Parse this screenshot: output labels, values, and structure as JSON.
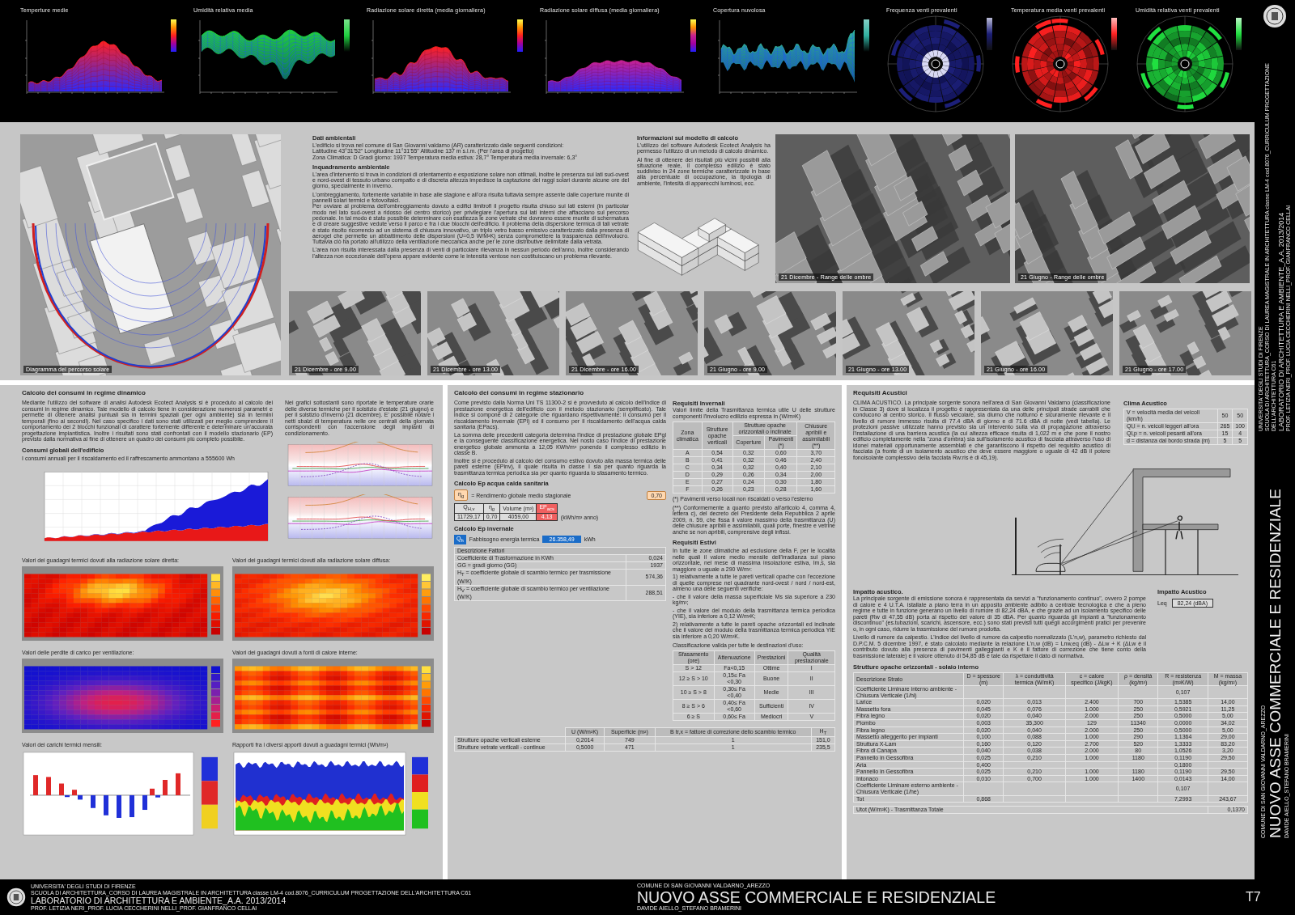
{
  "climate_strip": {
    "charts": [
      {
        "kind": "area",
        "title": "Temperture medie",
        "color": "#ff2020"
      },
      {
        "kind": "band",
        "title": "Umidità relativa media",
        "color": "#20d040"
      },
      {
        "kind": "area",
        "title": "Radiazione solare diretta (media giornaliera)",
        "color": "#ff2020"
      },
      {
        "kind": "area",
        "title": "Radiazione solare diffusa (media giornaliera)",
        "color": "#c82090"
      },
      {
        "kind": "band",
        "title": "Copertura nuvolosa",
        "color": "#30b0a0"
      },
      {
        "kind": "rose",
        "title": "Frequenza venti prevalenti",
        "color": "#1c1f78"
      },
      {
        "kind": "rose",
        "title": "Temperatura media venti prevalenti",
        "color": "#ff2020"
      },
      {
        "kind": "rose",
        "title": "Umidità relativa venti prevalenti",
        "color": "#20e040"
      }
    ]
  },
  "side_strip": {
    "credits": [
      {
        "text": "UNIVERSITA' DEGLI STUDI DI FIRENZE",
        "kind": "small"
      },
      {
        "text": "SCUOLA DI ARCHITETTURA_CORSO DI LAUREA MAGISTRALE IN ARCHITETTURA classe LM-4 cod.8076_CURRICULUM PROGETTAZIONE DELL'ARCHITETTURA C61",
        "kind": "small"
      },
      {
        "text": "LABORATORIO DI ARCHITETTURA E AMBIENTE_A.A. 2013/2014",
        "kind": "large"
      },
      {
        "text": "PROF. LETIZIA NERI_PROF. LUCIA CECCHERINI NELLI_PROF. GIANFRANCO CELLAI",
        "kind": "small"
      }
    ],
    "place": "COMUNE DI SAN GIOVANNI VALDARNO_AREZZO",
    "title": "NUOVO ASSE COMMERCIALE E RESIDENZIALE",
    "authors": "DAVIDE AIELLO_STEFANO BRAMERINI"
  },
  "site_analysis": {
    "sun_path_caption": "Diagramma del percorso solare",
    "environment": [
      {
        "kind": "heading",
        "text": "Dati ambientali"
      },
      {
        "kind": "paragraph",
        "text": "L'edificio si trova nel comune di San Giovanni valdarno (AR) caratterizzato dalle seguenti condizioni:"
      },
      {
        "kind": "line",
        "text": "Latitudine 43°31'52\"  Longitudine 11°31'55\"  Altitudine 137 m s.l.m. (Per l'area di progetto)"
      },
      {
        "kind": "line",
        "text": "Zona Climatica: D  Gradi giorno: 1937  Temperatura media estiva: 28,7°  Temperatura media invernale: 6,3°"
      },
      {
        "kind": "heading",
        "text": "Inquadramento ambientale"
      },
      {
        "kind": "paragraph",
        "text": "L'area d'intervento si trova in condizioni di orientamento e esposizione solare non ottimali, inoltre le presenza sui lati sud-ovest e nord-ovest di tessuto urbano compatto e di discreta altezza impedisce la captazione dei raggi solari durante alcune ore del giorno, specialmente in inverno."
      },
      {
        "kind": "paragraph",
        "text": "L'ombreggiamento, fortemente variabile in base alle stagione e all'ora risulta tuttavia sempre assente dalle coperture munite di pannelli solari termici e fotovoltaici."
      },
      {
        "kind": "line",
        "text": "Per ovviare al problema dell'ombreggiamento dovuto a edifici limitrofi il progetto risulta chiuso sui lati esterni (in particolar modo nel lato sud-ovest a ridosso del centro storico) per privilegiare l'apertura sui lati interni che affacciano sul percorso pedonale. In tal modo è stato possibile determinare con esattezza le zone vetrate che dovranno essere munite di schermatura e di creare suggestive vedute verso il parco e fra i due blocchi dell'edificio. Il problema della dispersione termica di tali vetrate è stato risolto ricorrendo ad un sistema di chiusura innovativo, un triplo vetro basso emissivo caratterizzato dalla presenza di aerogel che permette un abbattimento delle dispersioni (U=0,5 W/M²K) senza compromettere la trasparenza dell'involucro. Tuttavia ciò ha portato all'utilizzo della ventilazione meccanica anche per le zone distributive delimitate dalla vetrata."
      },
      {
        "kind": "paragraph",
        "text": "L'area non risulta interessata dalla presenza di venti di particolare rilevanza in nessun periodo dell'anno, inoltre considerando l'altezza non eccezionale dell'opera appare evidente come le intensità ventose non costituiscano un problema rilevante."
      }
    ],
    "model_info": [
      {
        "kind": "heading",
        "text": "Informazioni sul modello di calcolo"
      },
      {
        "kind": "paragraph",
        "text": "L'utilizzo del software Autodesk Ecotect Analysis ha permesso l'utilizzo di un metodo di calcolo dinamico."
      },
      {
        "kind": "paragraph",
        "text": "Al fine di ottenere dei risultati più vicini possibili alla situazione reale, il complesso edilizio è stato suddiviso in 24 zone termiche caratterizzate in base alla percentuale di occupazione, la tipologia di ambiente, l'intesità di apparecchi luminosi, ecc."
      }
    ],
    "renders": [
      {
        "caption": "21 Dicembre - Range delle ombre"
      },
      {
        "caption": "21 Giugno - Range delle ombre"
      }
    ],
    "shadow_studies": [
      {
        "caption": "21 Dicembre - ore 9.00"
      },
      {
        "caption": "21 Dicembre - ore 13.00"
      },
      {
        "caption": "21 Dicembre - ore 16.00"
      },
      {
        "caption": "21 Giugno - ore 9.00"
      },
      {
        "caption": "21 Giugno - ore 13.00"
      },
      {
        "caption": "21 Giugno - ore 16.00"
      },
      {
        "caption": "21 Giugno - ore 17.00"
      }
    ]
  },
  "dynamic_analysis": {
    "heading": "Calcolo dei consumi in regime dinamico",
    "intro": "Mediante l'utilizzo del software di analisi Autodesk Ecotect Analysis si è proceduto al calcolo dei consumi in regime dinamico. Tale modello di calcolo tiene in considerazione numerosi parametri e permette di ottenere analisi puntuali sia in termini spaziali (per ogni ambiente) sia in termini temporali (fino ai secondi). Nel caso specifico i dati sono stati utilizzati per meglio comprendere il comportamento dei 2 blocchi funzionali di carattere fortemente differente e determinare un'accurata progettazione impiantistica. Inoltre i risultati sono stati confrontati con il modello stazionario (EP) previsto dalla normativa al fine di ottenere un quadro dei consumi più completo possibile.",
    "note": "Nei grafici sottostanti sono riportate le temperature orarie delle diverse termiche per il solstizio d'estate (21 giugno) e per il solstizio d'inverno (21 dicembre). E' possibile notare i netti sbalzi di temperatura nelle ore centrali della giornata corrispondenti con l'accensione degli impianti di condizionamento.",
    "subheading": "Consumi globali dell'edificio",
    "total": "I consumi annuali per il riscaldamento ed il raffrescamento ammontano a 555600 Wh",
    "charts": [
      {
        "kind": "heatmap",
        "title": "Valori dei guadagni termici dovuti alla radiazione solare diretta:"
      },
      {
        "kind": "heatmap",
        "title": "Valori dei guadagni termici dovuti alla radiazione solare diffusa:"
      },
      {
        "kind": "heatmap",
        "title": "Valori delle perdite di carico per ventilazione:"
      },
      {
        "kind": "heatmap",
        "title": "Valori dei guadagni dovuti a fonti di calore interne:"
      },
      {
        "kind": "bars",
        "title": "Valori dei carichi termici mensili:"
      },
      {
        "kind": "ratios",
        "title": "Rapporti fra i diversi apporti dovuti a guadagni termici (Wh/m²)"
      }
    ]
  },
  "stationary_analysis": {
    "heading": "Calcolo dei consumi in regime stazionario",
    "paragraphs": [
      "Come previsto dalla Norma Uni TS 11300-2 si è provveduto al calcolo dell'indice di prestazione energetica dell'edificio con il metodo stazionario (semplificato). Tale indice si compone di 2 categorie che riguardano rispettivamente: il consumo per il riscaldamento invernale (EPi) ed il consumo per il riscaldamento dell'acqua calda sanitaria (EPacs).",
      "La somma delle precedenti categoria determina l'indice di prestazione globale EPgl e la conseguente classificazione energetica. Nel nosto caso l'indice di prestazione energetico globale ammonta a 12,05 KWh/m³ ponendo il complesso edilizio in classe B.",
      "Inoltre si è proceduto al calcolo del consumo estivo dovuto alla massa termica delle pareti esterne (EPinv), il quale risulta in classe I sia per quanto riguarda la trasmittanza termica periodica sia per quanto riguarda lo sfasamento termico."
    ],
    "acs": {
      "heading": "Calcolo Ep acqua calda sanitaria",
      "efficiency": {
        "symbol": "η$_{g}$",
        "label": "= Rendimento globale medio stagionale",
        "value": "0,70"
      },
      "columns": [
        "Q$_{H,v}$",
        "η$_{g}$",
        "Volume (m³)",
        "EP$_{acs}$"
      ],
      "row": [
        "11729,17",
        "0,70",
        "4059,00",
        "4,13"
      ],
      "unit": "(kWh/m³ anno)"
    },
    "winter": {
      "heading": "Calcolo Ep invernale",
      "demand": {
        "symbol": "Q$_{h}$",
        "label": "Fabbisogno energia termica",
        "value": "26.358,49",
        "unit": "kWh"
      },
      "factors_heading": "Descrizione Fattori",
      "factors": [
        {
          "label": "Coefficiente di Trasformazione in KWh",
          "value": "0,024"
        },
        {
          "label": "GG = gradi giorno (GG)",
          "value": "1937"
        },
        {
          "label": "H$_{T}$ = coefficiente globale di scambio termico per trasmissione (W/K)",
          "value": "574,36"
        },
        {
          "label": "H$_{V}$ = coefficiente globale di scambio termico per ventilazione (W/K)",
          "value": "288,51"
        }
      ],
      "transmission": {
        "columns": [
          "",
          "U (W/m²K)",
          "Superficie (m²)",
          "B tr,x = fattore di correzione dello scambio termico",
          "H$_{T}$"
        ],
        "rows": [
          [
            "Strutture opache verticali esterne",
            "0,2014",
            "749",
            "1",
            "151,0"
          ],
          [
            "Strutture vetrate verticali - continue",
            "0,5000",
            "471",
            "1",
            "235,5"
          ]
        ]
      }
    },
    "winter_requirements": {
      "heading": "Requisiti Invernali",
      "text": "Valori limite della Trasmittanza termica utile U delle strutture componenti l'involucro edilizio espressa in (W/m²K)",
      "group_header": "Strutture opache orizzontali o inclinate",
      "columns": [
        "Zona climatica",
        "Strutture opache verticali",
        "Coperture",
        "Pavimenti (*)",
        "Chiusure apribili e assimilabili (**)"
      ],
      "rows": [
        [
          "A",
          "0,54",
          "0,32",
          "0,60",
          "3,70"
        ],
        [
          "B",
          "0,41",
          "0,32",
          "0,46",
          "2,40"
        ],
        [
          "C",
          "0,34",
          "0,32",
          "0,40",
          "2,10"
        ],
        [
          "D",
          "0,29",
          "0,26",
          "0,34",
          "2,00"
        ],
        [
          "E",
          "0,27",
          "0,24",
          "0,30",
          "1,80"
        ],
        [
          "F",
          "0,26",
          "0,23",
          "0,28",
          "1,60"
        ]
      ],
      "notes": [
        "(*) Pavimenti verso locali non riscaldati o verso l'esterno",
        "(**) Conformemente a quanto previsto all'articolo 4, comma 4, lettera c), del decreto del Presidente della Repubblica 2 aprile 2009, n. 59, che fissa il valore massimo della trasmittanza (U) delle chiusure apribili e assimilabili, quali porte, finestre e vetrine anche se non apribili, comprensive degli infissi."
      ]
    },
    "summer_requirements": {
      "heading": "Requisiti Estivi",
      "paragraphs": [
        "In tutte le zone climatiche ad esclusione della F, per le località nelle quali il valore medio mensile dell'irradianza sul piano orizzontale, nel mese di massima insolazione estiva, Im,s, sia maggiore o uguale a 290 W/m²:",
        "1) relativamente a tutte le pareti verticali opache con l'eccezione di quelle comprese nel quadrante nord-ovest / nord / nord-est, almeno una delle seguenti verifiche:",
        "- che il valore della massa superficiale Ms sia superiore a 230 kg/m²;",
        "- che il valore del modulo della trasmittanza termica periodica (YIE), sia inferiore a 0,12 W/m²K;",
        "2) relativamente a tutte le pareti opache orizzontali ed inclinate che il valore del modulo della trasmittanza termica periodica YIE sia inferiore a 0,20 W/m²K."
      ],
      "class_title": "Classificazione valida per tutte le destinazioni d'uso:",
      "columns": [
        "Sfasamento (ore)",
        "Attenuazione",
        "Prestazioni",
        "Qualità prestazionale"
      ],
      "rows": [
        [
          "S > 12",
          "Fa<0,15",
          "Ottime",
          "I"
        ],
        [
          "12 ≥ S > 10",
          "0,15≤ Fa <0,30",
          "Buone",
          "II"
        ],
        [
          "10 ≥ S > 8",
          "0,30≤ Fa <0,40",
          "Medie",
          "III"
        ],
        [
          "8 ≥ S > 6",
          "0,40≤ Fa <0,60",
          "Sufficienti",
          "IV"
        ],
        [
          "6 ≥ S",
          "0,60≤ Fa",
          "Mediocri",
          "V"
        ]
      ]
    }
  },
  "acoustics": {
    "heading": "Requisiti Acustici",
    "text": "CLIMA ACUSTICO. La principale sorgente sonora nell'area di San Giovanni Valdarno (classificazione in Classe 3) dove si localizza il progetto è rappresentata da una delle principali strade carrabili che conducono al centro storico. Il flusso veicolare, sia diurno che notturno è sicuramente rilevante e il livello di rumore immesso risulta di 77.4 dBA di giorno e di 71.6 dBA di notte (vedi tabella). Le protezioni passive utilizzate hanno previsto sia un intervento sulla via di propagazione attraverso l'installazione di una barriera acustica (la cui altezza efficace risulta di 1,022 m e che pone il nostro edificio completamente nella \"zona d'ombra) sia sull'isolamento acustico di facciata attraverso l'uso di idonei materiali opportunamente assemblati e che garantiscono il rispetto del requisito acustico di facciata (a fronte di un isolamento acustico che deve essere maggiore o uguale di 42 dB il potere fonoisolante complessivo della facciata Rw:ris è di 45,19).",
    "climate": {
      "title": "Clima Acustico",
      "rows": [
        {
          "label": "V = velocità media dei veicoli (km/h)",
          "values": [
            "50",
            "50"
          ]
        },
        {
          "label": "Ql,l = n. veicoli leggeri all'ora",
          "values": [
            "265",
            "100"
          ]
        },
        {
          "label": "Ql,p = n. veicoli pesanti all'ora",
          "values": [
            "15",
            "4"
          ]
        },
        {
          "label": "d = distanza dal bordo strada (m)",
          "values": [
            "5",
            "5"
          ]
        }
      ]
    },
    "impact": [
      {
        "kind": "heading",
        "text": "Impatto acustico."
      },
      {
        "kind": "paragraph",
        "text": "La principale sorgente di emissione sonora è rappresentata da servizi a \"funzionamento continuo\", ovvero 2 pompe di calore e 4 U.T.A. istallate a piano terra in un apposito ambiente adibito a centrale tecnologica e che a pieno regime e tutte in funzione generano un livello di rumore di 82,24 dBA, e che grazie ad un isolamento specifico delle pareti (Rw di 47,55 dB) porta al rispetto del valore di 35 dBA. Per quanto riguarda gli impianti a \"funzionamento discontinuo\" (es.tubazioni, scarichi, ascensore, ecc.) sono stati previsti tutti quegli accorgimenti pratici per prevenire o, in ogni caso, ridurre la trasmissione del rumore prodotta."
      },
      {
        "kind": "paragraph",
        "text": "Livello di rumore da calpestio. L'indice del livello di rumore da calpestio normalizzato (L'n,w), parametro richiesto dal D.P.C.M. 5 dicembre 1997, è stato calcolato mediante la relazione L'n,w (dB) = Lnw,eq (dB) - ΔLw + K (ΔLw è il contributo dovuto alla presenza di pavimenti galleggianti e K è il fattore di correzione che tiene conto della trasmissione laterale) e il valore ottenuto di 54,85 dB è tale da rispettare il dato di normativa."
      }
    ],
    "impact_box": {
      "title": "Impatto Acustico",
      "total_label": "Leq",
      "total_value": "82,24 (dBA)"
    },
    "floor_structure": {
      "title": "Strutture opache orizzontali - solaio interno",
      "columns": [
        "Descrizione Strato",
        "D = spessore (m)",
        "λ = conduttività termica (W/mK)",
        "c = calore specifico (J/kgK)",
        "ρ = densità (kg/m³)",
        "R = resistenza (m²K/W)",
        "M = massa (kg/m²)"
      ],
      "rows": [
        [
          "Coefficiente Liminare interno ambiente - Chiusura Verticale (1/hi)",
          "",
          "",
          "",
          "",
          "0,107",
          ""
        ],
        [
          "Larice",
          "0,020",
          "0,013",
          "2.400",
          "700",
          "1,5385",
          "14,00"
        ],
        [
          "Massetto fora",
          "0,045",
          "0,076",
          "1.000",
          "250",
          "0,5921",
          "11,25"
        ],
        [
          "Fibra legno",
          "0,020",
          "0,040",
          "2.000",
          "250",
          "0,5000",
          "5,00"
        ],
        [
          "Piombo",
          "0,003",
          "35,300",
          "129",
          "11340",
          "0,0000",
          "34,02"
        ],
        [
          "Fibra legno",
          "0,020",
          "0,040",
          "2.000",
          "250",
          "0,5000",
          "5,00"
        ],
        [
          "Massetto alleggerito per impianti",
          "0,100",
          "0,088",
          "1.000",
          "290",
          "1,1364",
          "29,00"
        ],
        [
          "Struttura X-Lam",
          "0,160",
          "0,120",
          "2.700",
          "520",
          "1,3333",
          "83,20"
        ],
        [
          "Fibra di Canapa",
          "0,040",
          "0,038",
          "2.000",
          "80",
          "1,0526",
          "3,20"
        ],
        [
          "Pannello in Gessofibra",
          "0,025",
          "0,210",
          "1.000",
          "1180",
          "0,1190",
          "29,50"
        ],
        [
          "Aria",
          "0,400",
          "",
          "",
          "",
          "0,1800",
          ""
        ],
        [
          "Pannello in Gessofibra",
          "0,025",
          "0,210",
          "1.000",
          "1180",
          "0,1190",
          "29,50"
        ],
        [
          "Intonaco",
          "0,010",
          "0,700",
          "1.000",
          "1400",
          "0,0143",
          "14,00"
        ],
        [
          "Coefficiente Liminare esterno ambiente - Chiusura Verticale (1/he)",
          "",
          "",
          "",
          "",
          "0,107",
          ""
        ],
        [
          "Tot",
          "0,868",
          "",
          "",
          "",
          "7,2993",
          "243,67"
        ]
      ],
      "summary": [
        {
          "label": "Utot (W/m²K) - Trasmittanza Totale",
          "value": "0,1370"
        }
      ]
    }
  },
  "footer": {
    "credits": [
      {
        "text": "UNIVERSITA' DEGLI STUDI DI FIRENZE",
        "kind": "small"
      },
      {
        "text": "SCUOLA DI ARCHITETTURA_CORSO DI LAUREA MAGISTRALE IN ARCHITETTURA classe LM-4 cod.8076_CURRICULUM PROGETTAZIONE DELL'ARCHITETTURA C61",
        "kind": "small"
      },
      {
        "text": "LABORATORIO DI ARCHITETTURA E AMBIENTE_A.A. 2013/2014",
        "kind": "large"
      },
      {
        "text": "PROF. LETIZIA NERI_PROF. LUCIA CECCHERINI NELLI_PROF. GIANFRANCO CELLAI",
        "kind": "small"
      }
    ],
    "place": "COMUNE DI SAN GIOVANNI VALDARNO_AREZZO",
    "title": "NUOVO ASSE COMMERCIALE E RESIDENZIALE",
    "authors": "DAVIDE AIELLO_STEFANO BRAMERINI",
    "sheet": "T7"
  }
}
